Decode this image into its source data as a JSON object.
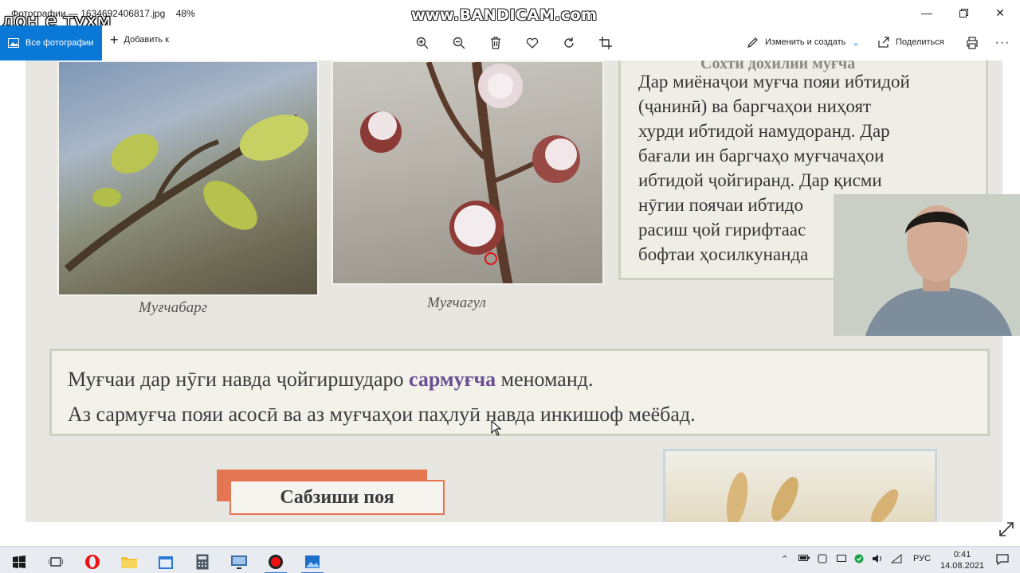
{
  "window": {
    "title": "Фотографии — 1634692406817.jpg",
    "zoom": "48%",
    "overlay_caption": "дон е тухм",
    "watermark": "www.BANDICAM.com"
  },
  "toolbar": {
    "all_photos_label": "Все фотографии",
    "add_label": "Добавить к",
    "edit_create_label": "Изменить и создать",
    "share_label": "Поделиться"
  },
  "page": {
    "caption_left": "Муғчабарг",
    "caption_right": "Муғчагул",
    "textbox_heading": "Сохти дохилии муғча",
    "textbox_lines": [
      "Дар миёнаҷои муғча пояи ибтидой",
      "(ҷанинӣ) ва  баргчаҳои ниҳоят",
      "хурди ибтидой намудоранд. Дар",
      "бағали ин баргчаҳо муғчачаҳои",
      "ибтидой  ҷойгиранд. Дар қисми",
      "нӯгии поячаи ибтидо",
      "расиш ҷой гирифтаас",
      "бофтаи ҳосилкунанда"
    ],
    "bigbox_line1_before": "Муғчаи дар нӯги навда ҷойгиршударо ",
    "bigbox_line1_highlight": "сармуғча",
    "bigbox_line1_after": " меноманд.",
    "bigbox_line2": "Аз сармуғча пояи асосӣ ва аз муғчаҳои паҳлуӣ навда инкишоф меёбад.",
    "section_title": "Сабзиши поя"
  },
  "taskbar": {
    "language": "РУС",
    "time": "0:41",
    "date": "14.08.2021"
  },
  "colors": {
    "accent": "#0a78d7",
    "highlight": "#6a4e93",
    "section": "#e47653"
  }
}
